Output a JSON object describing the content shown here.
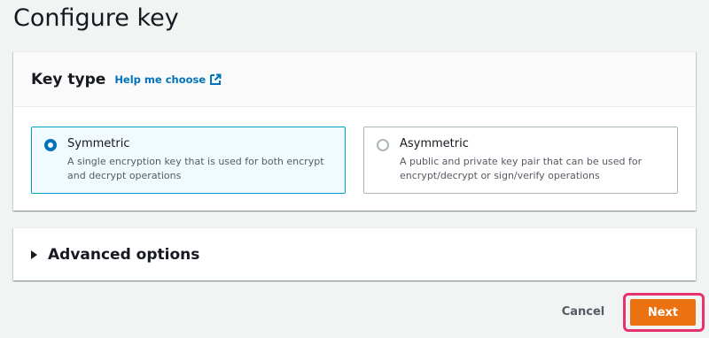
{
  "page": {
    "title": "Configure key"
  },
  "key_type": {
    "title": "Key type",
    "help_link": "Help me choose",
    "options": [
      {
        "label": "Symmetric",
        "description": "A single encryption key that is used for both encrypt and decrypt operations",
        "selected": true
      },
      {
        "label": "Asymmetric",
        "description": "A public and private key pair that can be used for encrypt/decrypt or sign/verify operations",
        "selected": false
      }
    ]
  },
  "advanced": {
    "label": "Advanced options",
    "expanded": false
  },
  "footer": {
    "cancel_label": "Cancel",
    "next_label": "Next"
  },
  "colors": {
    "accent": "#0073bb",
    "primary_button": "#ec7211",
    "highlight": "#e8326f",
    "selected_border": "#00a1c9"
  },
  "icons": {
    "help_link_icon": "external-link-icon",
    "advanced_icon": "caret-right-icon"
  }
}
